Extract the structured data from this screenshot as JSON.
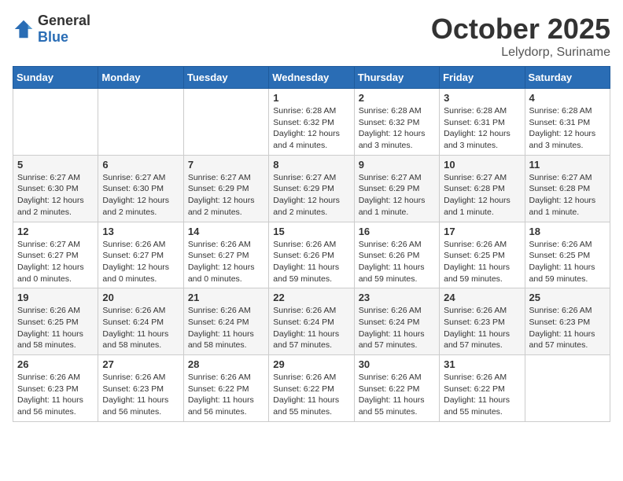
{
  "header": {
    "logo_general": "General",
    "logo_blue": "Blue",
    "month": "October 2025",
    "location": "Lelydorp, Suriname"
  },
  "weekdays": [
    "Sunday",
    "Monday",
    "Tuesday",
    "Wednesday",
    "Thursday",
    "Friday",
    "Saturday"
  ],
  "weeks": [
    [
      {
        "day": "",
        "info": ""
      },
      {
        "day": "",
        "info": ""
      },
      {
        "day": "",
        "info": ""
      },
      {
        "day": "1",
        "info": "Sunrise: 6:28 AM\nSunset: 6:32 PM\nDaylight: 12 hours\nand 4 minutes."
      },
      {
        "day": "2",
        "info": "Sunrise: 6:28 AM\nSunset: 6:32 PM\nDaylight: 12 hours\nand 3 minutes."
      },
      {
        "day": "3",
        "info": "Sunrise: 6:28 AM\nSunset: 6:31 PM\nDaylight: 12 hours\nand 3 minutes."
      },
      {
        "day": "4",
        "info": "Sunrise: 6:28 AM\nSunset: 6:31 PM\nDaylight: 12 hours\nand 3 minutes."
      }
    ],
    [
      {
        "day": "5",
        "info": "Sunrise: 6:27 AM\nSunset: 6:30 PM\nDaylight: 12 hours\nand 2 minutes."
      },
      {
        "day": "6",
        "info": "Sunrise: 6:27 AM\nSunset: 6:30 PM\nDaylight: 12 hours\nand 2 minutes."
      },
      {
        "day": "7",
        "info": "Sunrise: 6:27 AM\nSunset: 6:29 PM\nDaylight: 12 hours\nand 2 minutes."
      },
      {
        "day": "8",
        "info": "Sunrise: 6:27 AM\nSunset: 6:29 PM\nDaylight: 12 hours\nand 2 minutes."
      },
      {
        "day": "9",
        "info": "Sunrise: 6:27 AM\nSunset: 6:29 PM\nDaylight: 12 hours\nand 1 minute."
      },
      {
        "day": "10",
        "info": "Sunrise: 6:27 AM\nSunset: 6:28 PM\nDaylight: 12 hours\nand 1 minute."
      },
      {
        "day": "11",
        "info": "Sunrise: 6:27 AM\nSunset: 6:28 PM\nDaylight: 12 hours\nand 1 minute."
      }
    ],
    [
      {
        "day": "12",
        "info": "Sunrise: 6:27 AM\nSunset: 6:27 PM\nDaylight: 12 hours\nand 0 minutes."
      },
      {
        "day": "13",
        "info": "Sunrise: 6:26 AM\nSunset: 6:27 PM\nDaylight: 12 hours\nand 0 minutes."
      },
      {
        "day": "14",
        "info": "Sunrise: 6:26 AM\nSunset: 6:27 PM\nDaylight: 12 hours\nand 0 minutes."
      },
      {
        "day": "15",
        "info": "Sunrise: 6:26 AM\nSunset: 6:26 PM\nDaylight: 11 hours\nand 59 minutes."
      },
      {
        "day": "16",
        "info": "Sunrise: 6:26 AM\nSunset: 6:26 PM\nDaylight: 11 hours\nand 59 minutes."
      },
      {
        "day": "17",
        "info": "Sunrise: 6:26 AM\nSunset: 6:25 PM\nDaylight: 11 hours\nand 59 minutes."
      },
      {
        "day": "18",
        "info": "Sunrise: 6:26 AM\nSunset: 6:25 PM\nDaylight: 11 hours\nand 59 minutes."
      }
    ],
    [
      {
        "day": "19",
        "info": "Sunrise: 6:26 AM\nSunset: 6:25 PM\nDaylight: 11 hours\nand 58 minutes."
      },
      {
        "day": "20",
        "info": "Sunrise: 6:26 AM\nSunset: 6:24 PM\nDaylight: 11 hours\nand 58 minutes."
      },
      {
        "day": "21",
        "info": "Sunrise: 6:26 AM\nSunset: 6:24 PM\nDaylight: 11 hours\nand 58 minutes."
      },
      {
        "day": "22",
        "info": "Sunrise: 6:26 AM\nSunset: 6:24 PM\nDaylight: 11 hours\nand 57 minutes."
      },
      {
        "day": "23",
        "info": "Sunrise: 6:26 AM\nSunset: 6:24 PM\nDaylight: 11 hours\nand 57 minutes."
      },
      {
        "day": "24",
        "info": "Sunrise: 6:26 AM\nSunset: 6:23 PM\nDaylight: 11 hours\nand 57 minutes."
      },
      {
        "day": "25",
        "info": "Sunrise: 6:26 AM\nSunset: 6:23 PM\nDaylight: 11 hours\nand 57 minutes."
      }
    ],
    [
      {
        "day": "26",
        "info": "Sunrise: 6:26 AM\nSunset: 6:23 PM\nDaylight: 11 hours\nand 56 minutes."
      },
      {
        "day": "27",
        "info": "Sunrise: 6:26 AM\nSunset: 6:23 PM\nDaylight: 11 hours\nand 56 minutes."
      },
      {
        "day": "28",
        "info": "Sunrise: 6:26 AM\nSunset: 6:22 PM\nDaylight: 11 hours\nand 56 minutes."
      },
      {
        "day": "29",
        "info": "Sunrise: 6:26 AM\nSunset: 6:22 PM\nDaylight: 11 hours\nand 55 minutes."
      },
      {
        "day": "30",
        "info": "Sunrise: 6:26 AM\nSunset: 6:22 PM\nDaylight: 11 hours\nand 55 minutes."
      },
      {
        "day": "31",
        "info": "Sunrise: 6:26 AM\nSunset: 6:22 PM\nDaylight: 11 hours\nand 55 minutes."
      },
      {
        "day": "",
        "info": ""
      }
    ]
  ]
}
